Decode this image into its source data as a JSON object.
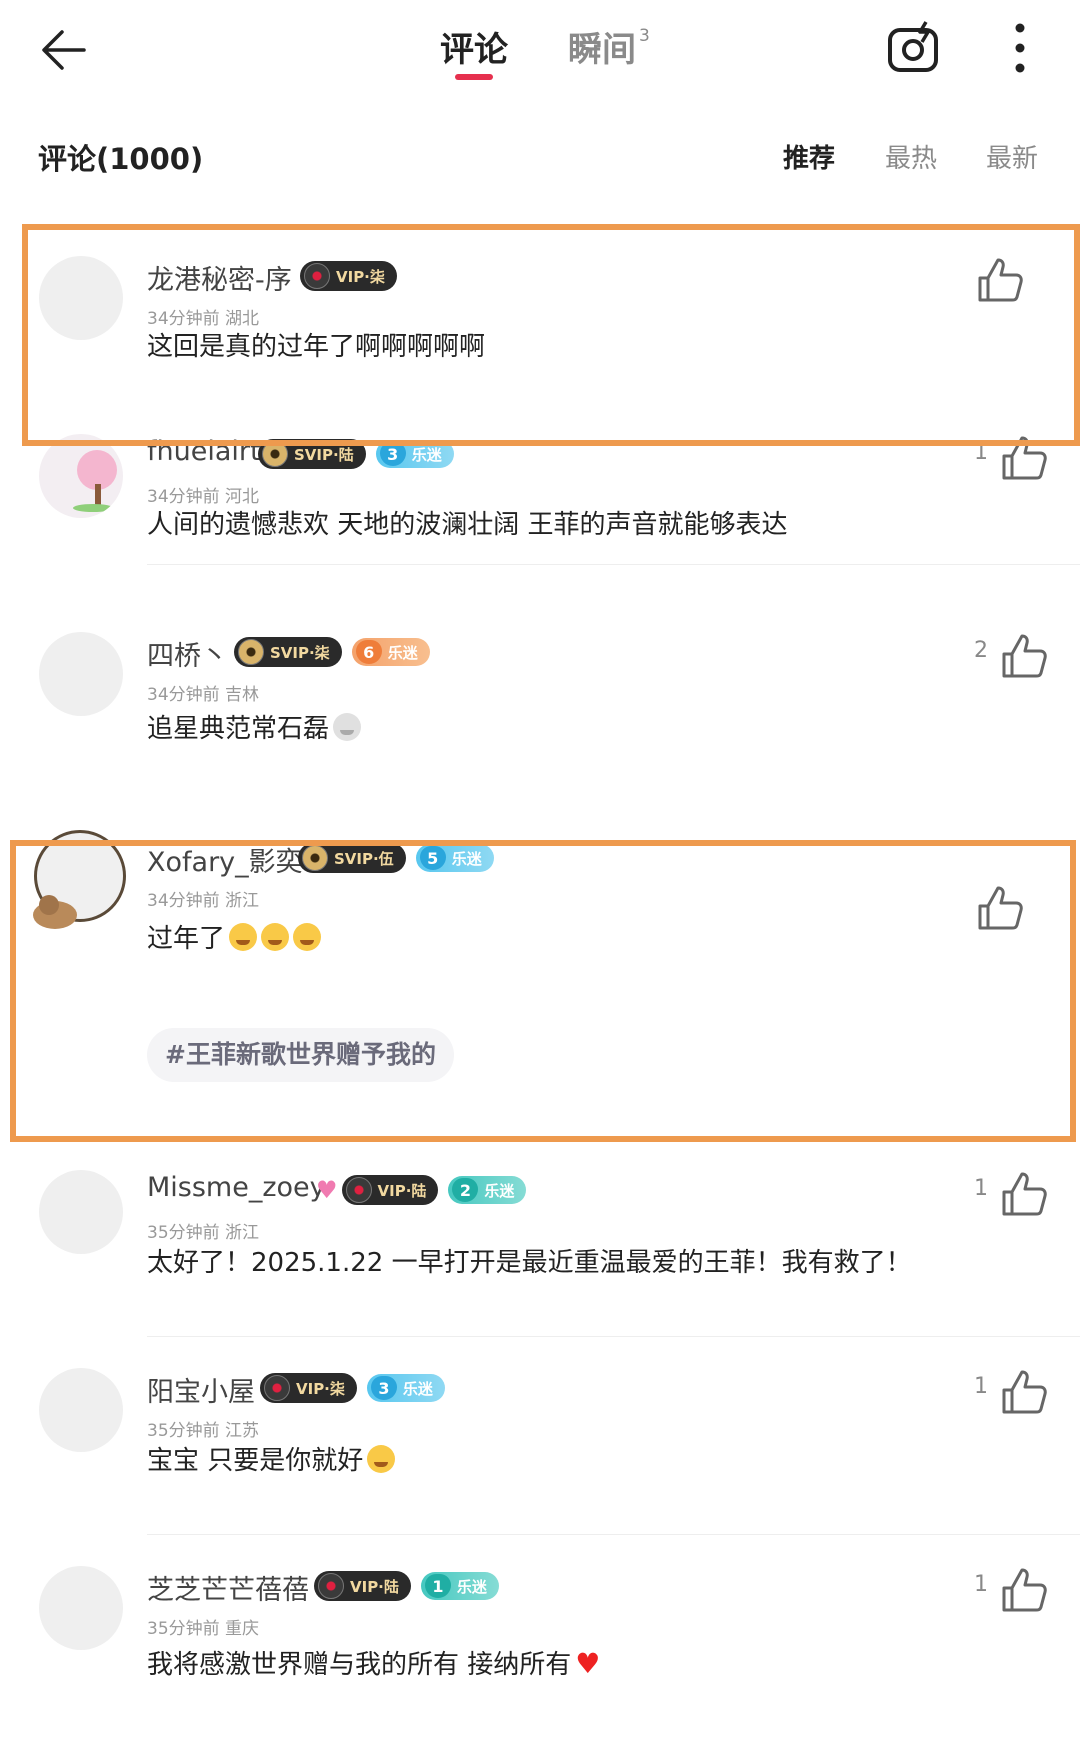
{
  "header": {
    "tab_comments": "评论",
    "tab_moments": "瞬间",
    "tab_moments_badge": "3"
  },
  "section": {
    "count_label": "评论(1000)",
    "sort_recommended": "推荐",
    "sort_hottest": "最热",
    "sort_newest": "最新"
  },
  "comments": [
    {
      "username": "龙港秘密-序",
      "vip": "VIP·柒",
      "time": "34分钟前",
      "region": "湖北",
      "text": "这回是真的过年了啊啊啊啊啊",
      "likes": ""
    },
    {
      "username": "fhuelalrt",
      "vip": "SVIP·陆",
      "fan_level": "3",
      "fan_label": "乐迷",
      "time": "34分钟前",
      "region": "河北",
      "text": "人间的遗憾悲欢 天地的波澜壮阔 王菲的声音就能够表达",
      "likes": "1"
    },
    {
      "username": "四桥丶",
      "vip": "SVIP·柒",
      "fan_level": "6",
      "fan_label": "乐迷",
      "time": "34分钟前",
      "region": "吉林",
      "text": "追星典范常石磊",
      "likes": "2"
    },
    {
      "username": "Xofary_影奕",
      "vip": "SVIP·伍",
      "fan_level": "5",
      "fan_label": "乐迷",
      "time": "34分钟前",
      "region": "浙江",
      "text": "过年了",
      "tag": "#王菲新歌世界赠予我的",
      "likes": ""
    },
    {
      "username": "Missme_zoey",
      "vip": "VIP·陆",
      "fan_level": "2",
      "fan_label": "乐迷",
      "time": "35分钟前",
      "region": "浙江",
      "text": "太好了！2025.1.22 一早打开是最近重温最爱的王菲！我有救了！",
      "likes": "1"
    },
    {
      "username": "阳宝小屋",
      "vip": "VIP·柒",
      "fan_level": "3",
      "fan_label": "乐迷",
      "time": "35分钟前",
      "region": "江苏",
      "text": "宝宝 只要是你就好",
      "likes": "1"
    },
    {
      "username": "芝芝芒芒蓓蓓",
      "vip": "VIP·陆",
      "fan_level": "1",
      "fan_label": "乐迷",
      "time": "35分钟前",
      "region": "重庆",
      "text": "我将感激世界赠与我的所有 接纳所有",
      "likes": "1"
    }
  ],
  "icons": [
    "back-arrow-icon",
    "camera-icon",
    "more-vertical-icon",
    "thumbs-up-icon",
    "vinyl-disc-icon",
    "fan-heart-icon"
  ],
  "colors": {
    "accent": "#e6304e",
    "highlight_border": "#ee9a4e",
    "vip_badge_bg": "#2a2a2a"
  }
}
